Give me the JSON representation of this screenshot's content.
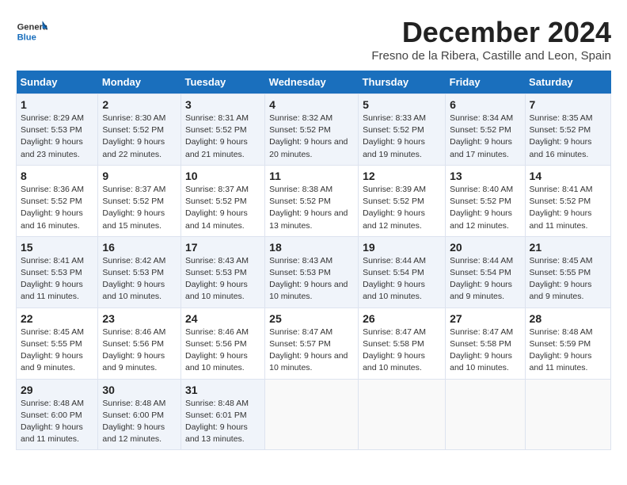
{
  "logo": {
    "line1": "General",
    "line2": "Blue"
  },
  "title": "December 2024",
  "subtitle": "Fresno de la Ribera, Castille and Leon, Spain",
  "days_of_week": [
    "Sunday",
    "Monday",
    "Tuesday",
    "Wednesday",
    "Thursday",
    "Friday",
    "Saturday"
  ],
  "weeks": [
    [
      {
        "day": "1",
        "sunrise": "8:29 AM",
        "sunset": "5:53 PM",
        "daylight": "9 hours and 23 minutes."
      },
      {
        "day": "2",
        "sunrise": "8:30 AM",
        "sunset": "5:52 PM",
        "daylight": "9 hours and 22 minutes."
      },
      {
        "day": "3",
        "sunrise": "8:31 AM",
        "sunset": "5:52 PM",
        "daylight": "9 hours and 21 minutes."
      },
      {
        "day": "4",
        "sunrise": "8:32 AM",
        "sunset": "5:52 PM",
        "daylight": "9 hours and 20 minutes."
      },
      {
        "day": "5",
        "sunrise": "8:33 AM",
        "sunset": "5:52 PM",
        "daylight": "9 hours and 19 minutes."
      },
      {
        "day": "6",
        "sunrise": "8:34 AM",
        "sunset": "5:52 PM",
        "daylight": "9 hours and 17 minutes."
      },
      {
        "day": "7",
        "sunrise": "8:35 AM",
        "sunset": "5:52 PM",
        "daylight": "9 hours and 16 minutes."
      }
    ],
    [
      {
        "day": "8",
        "sunrise": "8:36 AM",
        "sunset": "5:52 PM",
        "daylight": "9 hours and 16 minutes."
      },
      {
        "day": "9",
        "sunrise": "8:37 AM",
        "sunset": "5:52 PM",
        "daylight": "9 hours and 15 minutes."
      },
      {
        "day": "10",
        "sunrise": "8:37 AM",
        "sunset": "5:52 PM",
        "daylight": "9 hours and 14 minutes."
      },
      {
        "day": "11",
        "sunrise": "8:38 AM",
        "sunset": "5:52 PM",
        "daylight": "9 hours and 13 minutes."
      },
      {
        "day": "12",
        "sunrise": "8:39 AM",
        "sunset": "5:52 PM",
        "daylight": "9 hours and 12 minutes."
      },
      {
        "day": "13",
        "sunrise": "8:40 AM",
        "sunset": "5:52 PM",
        "daylight": "9 hours and 12 minutes."
      },
      {
        "day": "14",
        "sunrise": "8:41 AM",
        "sunset": "5:52 PM",
        "daylight": "9 hours and 11 minutes."
      }
    ],
    [
      {
        "day": "15",
        "sunrise": "8:41 AM",
        "sunset": "5:53 PM",
        "daylight": "9 hours and 11 minutes."
      },
      {
        "day": "16",
        "sunrise": "8:42 AM",
        "sunset": "5:53 PM",
        "daylight": "9 hours and 10 minutes."
      },
      {
        "day": "17",
        "sunrise": "8:43 AM",
        "sunset": "5:53 PM",
        "daylight": "9 hours and 10 minutes."
      },
      {
        "day": "18",
        "sunrise": "8:43 AM",
        "sunset": "5:53 PM",
        "daylight": "9 hours and 10 minutes."
      },
      {
        "day": "19",
        "sunrise": "8:44 AM",
        "sunset": "5:54 PM",
        "daylight": "9 hours and 10 minutes."
      },
      {
        "day": "20",
        "sunrise": "8:44 AM",
        "sunset": "5:54 PM",
        "daylight": "9 hours and 9 minutes."
      },
      {
        "day": "21",
        "sunrise": "8:45 AM",
        "sunset": "5:55 PM",
        "daylight": "9 hours and 9 minutes."
      }
    ],
    [
      {
        "day": "22",
        "sunrise": "8:45 AM",
        "sunset": "5:55 PM",
        "daylight": "9 hours and 9 minutes."
      },
      {
        "day": "23",
        "sunrise": "8:46 AM",
        "sunset": "5:56 PM",
        "daylight": "9 hours and 9 minutes."
      },
      {
        "day": "24",
        "sunrise": "8:46 AM",
        "sunset": "5:56 PM",
        "daylight": "9 hours and 10 minutes."
      },
      {
        "day": "25",
        "sunrise": "8:47 AM",
        "sunset": "5:57 PM",
        "daylight": "9 hours and 10 minutes."
      },
      {
        "day": "26",
        "sunrise": "8:47 AM",
        "sunset": "5:58 PM",
        "daylight": "9 hours and 10 minutes."
      },
      {
        "day": "27",
        "sunrise": "8:47 AM",
        "sunset": "5:58 PM",
        "daylight": "9 hours and 10 minutes."
      },
      {
        "day": "28",
        "sunrise": "8:48 AM",
        "sunset": "5:59 PM",
        "daylight": "9 hours and 11 minutes."
      }
    ],
    [
      {
        "day": "29",
        "sunrise": "8:48 AM",
        "sunset": "6:00 PM",
        "daylight": "9 hours and 11 minutes."
      },
      {
        "day": "30",
        "sunrise": "8:48 AM",
        "sunset": "6:00 PM",
        "daylight": "9 hours and 12 minutes."
      },
      {
        "day": "31",
        "sunrise": "8:48 AM",
        "sunset": "6:01 PM",
        "daylight": "9 hours and 13 minutes."
      },
      null,
      null,
      null,
      null
    ]
  ],
  "labels": {
    "sunrise": "Sunrise:",
    "sunset": "Sunset:",
    "daylight": "Daylight:"
  }
}
